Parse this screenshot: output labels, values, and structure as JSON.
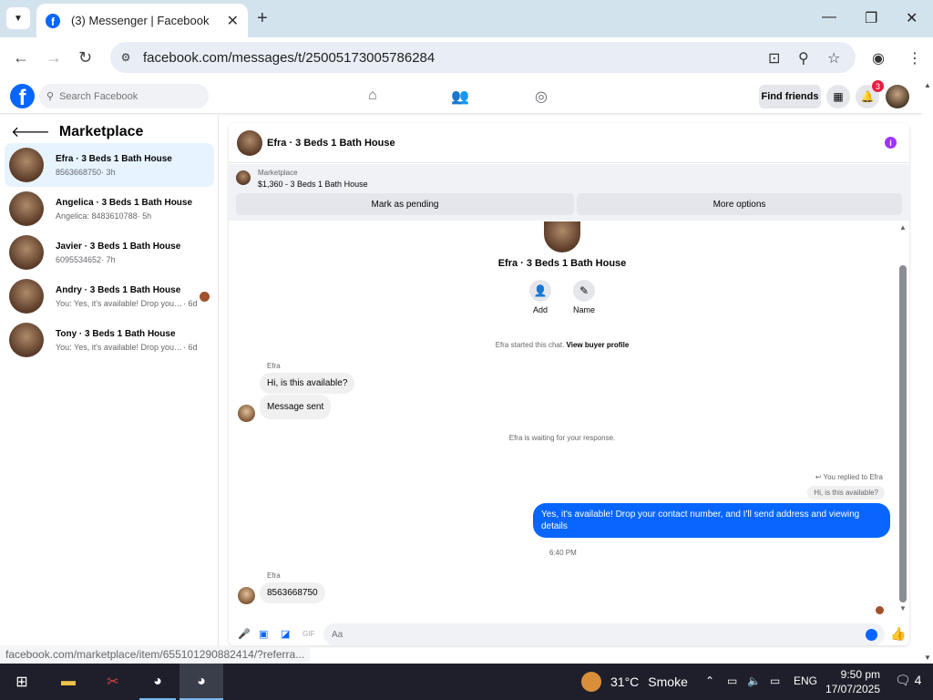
{
  "browser": {
    "tab_title": "(3) Messenger | Facebook",
    "url": "facebook.com/messages/t/25005173005786284",
    "status_url": "facebook.com/marketplace/item/655101290882414/?referra..."
  },
  "fb": {
    "search_placeholder": "Search Facebook",
    "find_friends": "Find friends",
    "notif_count": "3"
  },
  "sidebar": {
    "title": "Marketplace",
    "conversations": [
      {
        "name": "Efra · 3 Beds 1 Bath House",
        "sub": "8563668750",
        "time": "· 3h"
      },
      {
        "name": "Angelica · 3 Beds 1 Bath House",
        "sub": "Angelica: 8483610788",
        "time": "· 5h"
      },
      {
        "name": "Javier · 3 Beds 1 Bath House",
        "sub": "6095534652",
        "time": "· 7h"
      },
      {
        "name": "Andry · 3 Beds 1 Bath House",
        "sub": "You: Yes, it's available! Drop your c...",
        "time": "· 6d"
      },
      {
        "name": "Tony · 3 Beds 1 Bath House",
        "sub": "You: Yes, it's available! Drop your cont...",
        "time": "· 6d"
      }
    ]
  },
  "chat": {
    "header_name": "Efra · 3 Beds 1 Bath House",
    "marketplace_label": "Marketplace",
    "listing": "$1,360 - 3 Beds 1 Bath House",
    "mark_pending": "Mark as pending",
    "more_options": "More options",
    "profile_name": "Efra · 3 Beds 1 Bath House",
    "add_label": "Add",
    "name_label": "Name",
    "started": "Efra started this chat.",
    "view_buyer": "View buyer profile",
    "sender": "Efra",
    "msg1": "Hi, is this available?",
    "msg2": "Message sent",
    "waiting": "Efra is waiting for your response.",
    "replied_to": "You replied to Efra",
    "replied_quote": "Hi, is this available?",
    "outgoing": "Yes, it's available! Drop your contact number, and I'll send address and viewing details",
    "time": "6:40 PM",
    "sender2": "Efra",
    "msg3": "8563668750",
    "composer_placeholder": "Aa"
  },
  "taskbar": {
    "temp": "31°C",
    "weather": "Smoke",
    "lang": "ENG",
    "time": "9:50 pm",
    "date": "17/07/2025",
    "chat_count": "4"
  }
}
